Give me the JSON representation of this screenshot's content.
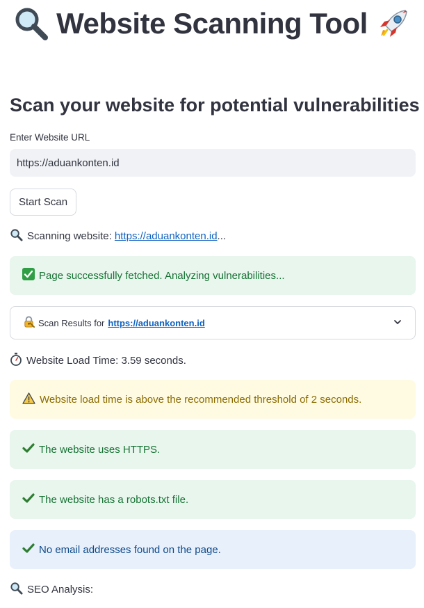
{
  "header": {
    "title": "Website Scanning Tool",
    "left_icon": "magnifier-icon",
    "right_icon": "rocket-icon"
  },
  "subheader": "Scan your website for potential vulnerabilities",
  "url_input": {
    "label": "Enter Website URL",
    "value": "https://aduankonten.id"
  },
  "scan_button": {
    "label": "Start Scan"
  },
  "scanning": {
    "prefix": "Scanning website:",
    "url": "https://aduankonten.id",
    "suffix": "..."
  },
  "fetched_alert": {
    "icon": "check-box-icon",
    "text": "Page successfully fetched. Analyzing vulnerabilities..."
  },
  "results_expander": {
    "icon": "lock-key-icon",
    "prefix": "Scan Results for",
    "url": "https://aduankonten.id",
    "expand_icon": "chevron-down-icon"
  },
  "load_time": {
    "icon": "stopwatch-icon",
    "text": "Website Load Time: 3.59 seconds."
  },
  "alerts": [
    {
      "type": "warning",
      "icon": "warning-icon",
      "text": "Website load time is above the recommended threshold of 2 seconds."
    },
    {
      "type": "success",
      "icon": "checkmark-icon",
      "text": "The website uses HTTPS."
    },
    {
      "type": "success",
      "icon": "checkmark-icon",
      "text": "The website has a robots.txt file."
    },
    {
      "type": "info",
      "icon": "checkmark-icon",
      "text": "No email addresses found on the page."
    }
  ],
  "seo_analysis": {
    "icon": "magnifier-icon",
    "text": "SEO Analysis:"
  },
  "colors": {
    "success_bg": "#e8f6ee",
    "success_text": "#177233",
    "warning_bg": "#fffbe3",
    "warning_text": "#8a6b00",
    "info_bg": "#e7f0fb",
    "info_text": "#104a8a",
    "link": "#0f62c0",
    "input_bg": "#f0f2f6"
  }
}
